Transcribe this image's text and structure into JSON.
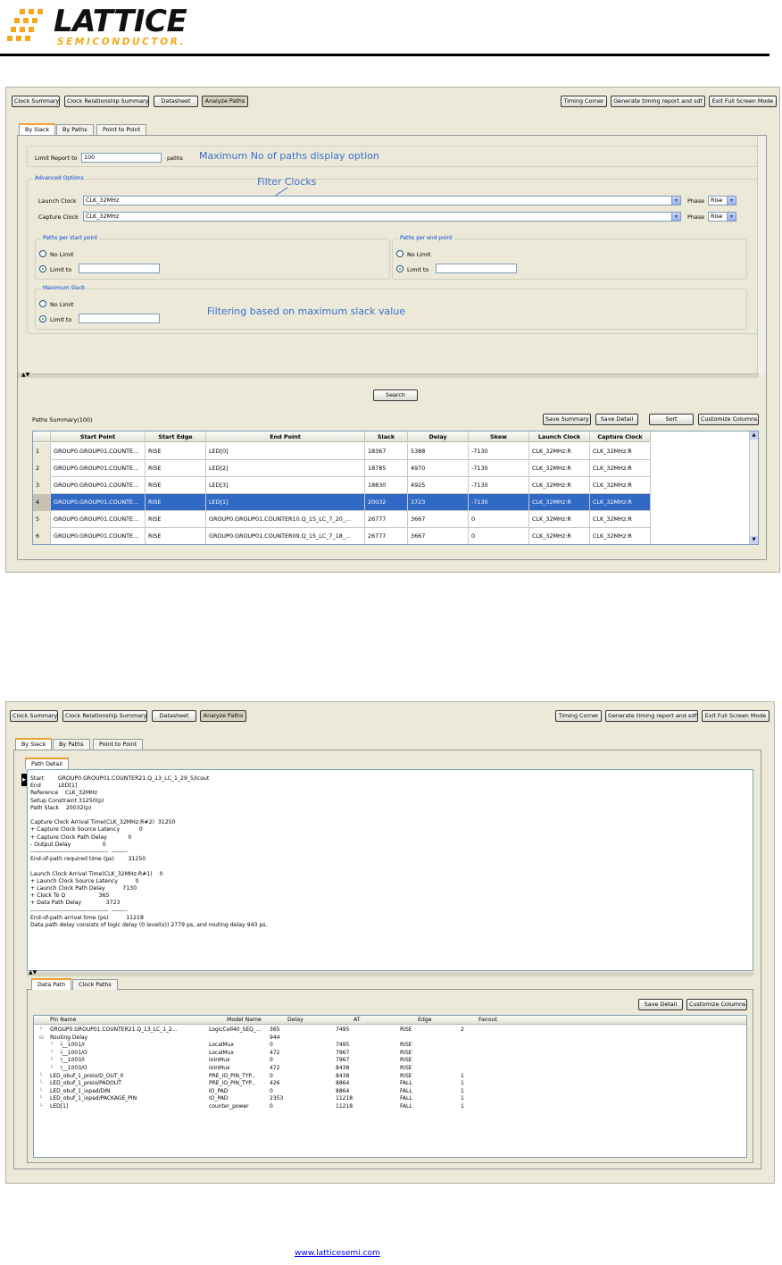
{
  "brand": {
    "name": "LATTICE",
    "tagline": "SEMICONDUCTOR."
  },
  "toolbar": {
    "clock_summary": "Clock Summary",
    "clock_relationship": "Clock Relationship Summary",
    "datasheet": "Datasheet",
    "analyze_paths": "Analyze Paths",
    "timing_corner": "Timing Corner",
    "generate_report": "Generate timing report and sdf",
    "exit_full_screen": "Exit Full Screen Mode"
  },
  "tabs": {
    "by_slack": "By Slack",
    "by_paths": "By Paths",
    "point_to_point": "Point to Point"
  },
  "top": {
    "limit_label": "Limit Report to",
    "limit_value": "100",
    "paths_label": "paths",
    "annot_max_paths": "Maximum No of paths display option",
    "advanced_title": "Advanced Options",
    "annot_filter_clocks": "Filter Clocks",
    "launch_label": "Launch Clock",
    "launch_value": "CLK_32MHz",
    "capture_label": "Capture Clock",
    "capture_value": "CLK_32MHz",
    "phase_label": "Phase",
    "phase_value": "Rise",
    "start_title": "Paths per start point",
    "end_title": "Paths per end point",
    "slack_title": "Maximum Slack",
    "no_limit": "No Limit",
    "limit_to": "Limit to",
    "annot_slack": "Filtering based on maximum slack value",
    "search": "Search",
    "summary_label": "Paths Summary(100)",
    "save_summary": "Save Summary",
    "save_detail": "Save Detail",
    "sort": "Sort",
    "customize": "Customize Columns",
    "columns": [
      "Start Point",
      "Start Edge",
      "End Point",
      "Slack",
      "Delay",
      "Skew",
      "Launch Clock",
      "Capture Clock"
    ],
    "rows": [
      [
        "1",
        "GROUP0.GROUP01.COUNTE...",
        "RISE",
        "LED[0]",
        "18367",
        "5388",
        "-7130",
        "CLK_32MHz:R",
        "CLK_32MHz:R"
      ],
      [
        "2",
        "GROUP0.GROUP01.COUNTE...",
        "RISE",
        "LED[2]",
        "18785",
        "4970",
        "-7130",
        "CLK_32MHz:R",
        "CLK_32MHz:R"
      ],
      [
        "3",
        "GROUP0.GROUP01.COUNTE...",
        "RISE",
        "LED[3]",
        "18830",
        "4925",
        "-7130",
        "CLK_32MHz:R",
        "CLK_32MHz:R"
      ],
      [
        "4",
        "GROUP0.GROUP01.COUNTE...",
        "RISE",
        "LED[1]",
        "20032",
        "3723",
        "-7130",
        "CLK_32MHz:R",
        "CLK_32MHz:R"
      ],
      [
        "5",
        "GROUP0.GROUP01.COUNTE...",
        "RISE",
        "GROUP0.GROUP01.COUNTER10.Q_15_LC_7_20_...",
        "26777",
        "3667",
        "0",
        "CLK_32MHz:R",
        "CLK_32MHz:R"
      ],
      [
        "6",
        "GROUP0.GROUP01.COUNTE...",
        "RISE",
        "GROUP0.GROUP01.COUNTER09.Q_15_LC_7_18_...",
        "26777",
        "3667",
        "0",
        "CLK_32MHz:R",
        "CLK_32MHz:R"
      ]
    ]
  },
  "bottom": {
    "path_detail_tab": "Path Detail",
    "detail_lines": [
      "Start        GROUP0.GROUP01.COUNTER21.Q_13_LC_1_29_5/lcout",
      "End          LED[1]",
      "Reference    CLK_32MHz",
      "Setup Constraint 31250(p)",
      "Path Slack    20032(p)",
      "",
      "Capture Clock Arrival Time(CLK_32MHz:R#2)  31250",
      "+ Capture Clock Source Latency           0",
      "+ Capture Clock Path Delay            0",
      "- Output Delay                  0",
      "---------------------------------------  --------",
      "End-of-path required time (ps)        31250",
      "",
      "Launch Clock Arrival Time(CLK_32MHz:R#1)    0",
      "+ Launch Clock Source Latency          0",
      "+ Launch Clock Path Delay          7130",
      "+ Clock To Q                   365",
      "+ Data Path Delay              3723",
      "---------------------------------------  --------",
      "End-of-path arrival time (ps)          11218",
      "Data path delay consists of logic delay (0 level(s)) 2779 ps, and routing delay 943 ps."
    ],
    "data_path_tab": "Data Path",
    "clock_paths_tab": "Clock Paths",
    "save_detail": "Save Detail",
    "customize": "Customize Columns",
    "columns": [
      "Pin Name",
      "Model Name",
      "Delay",
      "AT",
      "Edge",
      "Fanout"
    ],
    "rows": [
      [
        "GROUP0.GROUP01.COUNTER21.Q_13_LC_1_2...",
        "LogicCell40_SEQ_...",
        "365",
        "7495",
        "RISE",
        "2"
      ],
      [
        "Routing Delay",
        "",
        "944",
        "",
        "",
        ""
      ],
      [
        "I__1001/I",
        "LocalMux",
        "0",
        "7495",
        "RISE",
        ""
      ],
      [
        "I__1001/O",
        "LocalMux",
        "472",
        "7967",
        "RISE",
        ""
      ],
      [
        "I__1003/I",
        "IoInMux",
        "0",
        "7967",
        "RISE",
        ""
      ],
      [
        "I__1003/O",
        "IoInMux",
        "472",
        "8438",
        "RISE",
        ""
      ],
      [
        "LED_obuf_1_preio/D_OUT_0",
        "PRE_IO_PIN_TYP...",
        "0",
        "8438",
        "RISE",
        "1"
      ],
      [
        "LED_obuf_1_preio/PADOUT",
        "PRE_IO_PIN_TYP...",
        "426",
        "8864",
        "FALL",
        "1"
      ],
      [
        "LED_obuf_1_iopad/DIN",
        "IO_PAD",
        "0",
        "8864",
        "FALL",
        "1"
      ],
      [
        "LED_obuf_1_iopad/PACKAGE_PIN",
        "IO_PAD",
        "2353",
        "11218",
        "FALL",
        "1"
      ],
      [
        "LED[1]",
        "counter_power",
        "0",
        "11218",
        "FALL",
        "1"
      ]
    ]
  },
  "footer_link": "www.latticesemi.com"
}
